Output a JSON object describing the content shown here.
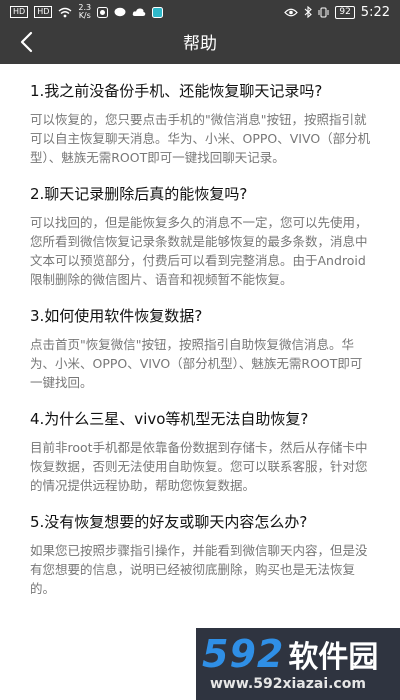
{
  "status_bar": {
    "left_tags": [
      "HD",
      "HD"
    ],
    "speed_value": "2.3",
    "speed_unit": "K/s",
    "battery": "92",
    "time": "5:22"
  },
  "header": {
    "title": "帮助"
  },
  "faq": [
    {
      "question": "1.我之前没备份手机、还能恢复聊天记录吗?",
      "answer": "可以恢复的，您只要点击手机的\"微信消息\"按钮，按照指引就可以自主恢复聊天消息。华为、小米、OPPO、VIVO（部分机型）、魅族无需ROOT即可一键找回聊天记录。"
    },
    {
      "question": "2.聊天记录删除后真的能恢复吗?",
      "answer": "可以找回的，但是能恢复多久的消息不一定，您可以先使用，您所看到微信恢复记录条数就是能够恢复的最多条数，消息中文本可以预览部分，付费后可以看到完整消息。由于Android限制删除的微信图片、语音和视频暂不能恢复。"
    },
    {
      "question": "3.如何使用软件恢复数据?",
      "answer": "点击首页\"恢复微信\"按钮，按照指引自助恢复微信消息。华为、小米、OPPO、VIVO（部分机型）、魅族无需ROOT即可一键找回。"
    },
    {
      "question": "4.为什么三星、vivo等机型无法自助恢复?",
      "answer": "目前非root手机都是依靠备份数据到存储卡，然后从存储卡中恢复数据，否则无法使用自助恢复。您可以联系客服，针对您的情况提供远程协助，帮助您恢复数据。"
    },
    {
      "question": "5.没有恢复想要的好友或聊天内容怎么办?",
      "answer": "如果您已按照步骤指引操作，并能看到微信聊天内容，但是没有您想要的信息，说明已经被彻底删除，购买也是无法恢复的。"
    }
  ],
  "watermark": {
    "logo_number": "592",
    "logo_name": "软件园",
    "url": "www.592xiazai.com"
  },
  "colors": {
    "header_bg": "#3b3b3b",
    "question_text": "#111111",
    "answer_text": "#777777",
    "watermark_bg": "#2f3440",
    "watermark_accent": "#2f8fe6"
  },
  "icons": {
    "back": "chevron-left-icon",
    "wifi": "wifi-icon",
    "eye": "eye-icon",
    "bluetooth": "bluetooth-icon",
    "battery": "battery-icon"
  }
}
